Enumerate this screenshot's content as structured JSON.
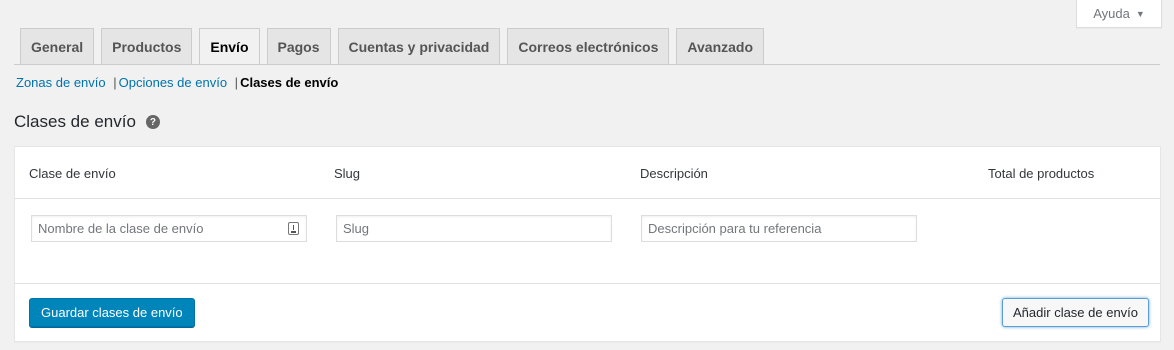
{
  "help": {
    "label": "Ayuda",
    "caret": "▼"
  },
  "tabs": [
    {
      "label": "General"
    },
    {
      "label": "Productos"
    },
    {
      "label": "Envío",
      "active": true
    },
    {
      "label": "Pagos"
    },
    {
      "label": "Cuentas y privacidad"
    },
    {
      "label": "Correos electrónicos"
    },
    {
      "label": "Avanzado"
    }
  ],
  "subnav": {
    "zones": "Zonas de envío",
    "options": "Opciones de envío",
    "classes": "Clases de envío",
    "separator": "|"
  },
  "section": {
    "title": "Clases de envío",
    "help_icon": "?"
  },
  "table": {
    "headers": {
      "class": "Clase de envío",
      "slug": "Slug",
      "description": "Descripción",
      "total": "Total de productos"
    },
    "placeholders": {
      "class": "Nombre de la clase de envío",
      "slug": "Slug",
      "description": "Descripción para tu referencia"
    }
  },
  "buttons": {
    "save": "Guardar clases de envío",
    "add": "Añadir clase de envío"
  },
  "colors": {
    "primary": "#0085ba",
    "link": "#0073aa",
    "background": "#f1f1f1"
  }
}
